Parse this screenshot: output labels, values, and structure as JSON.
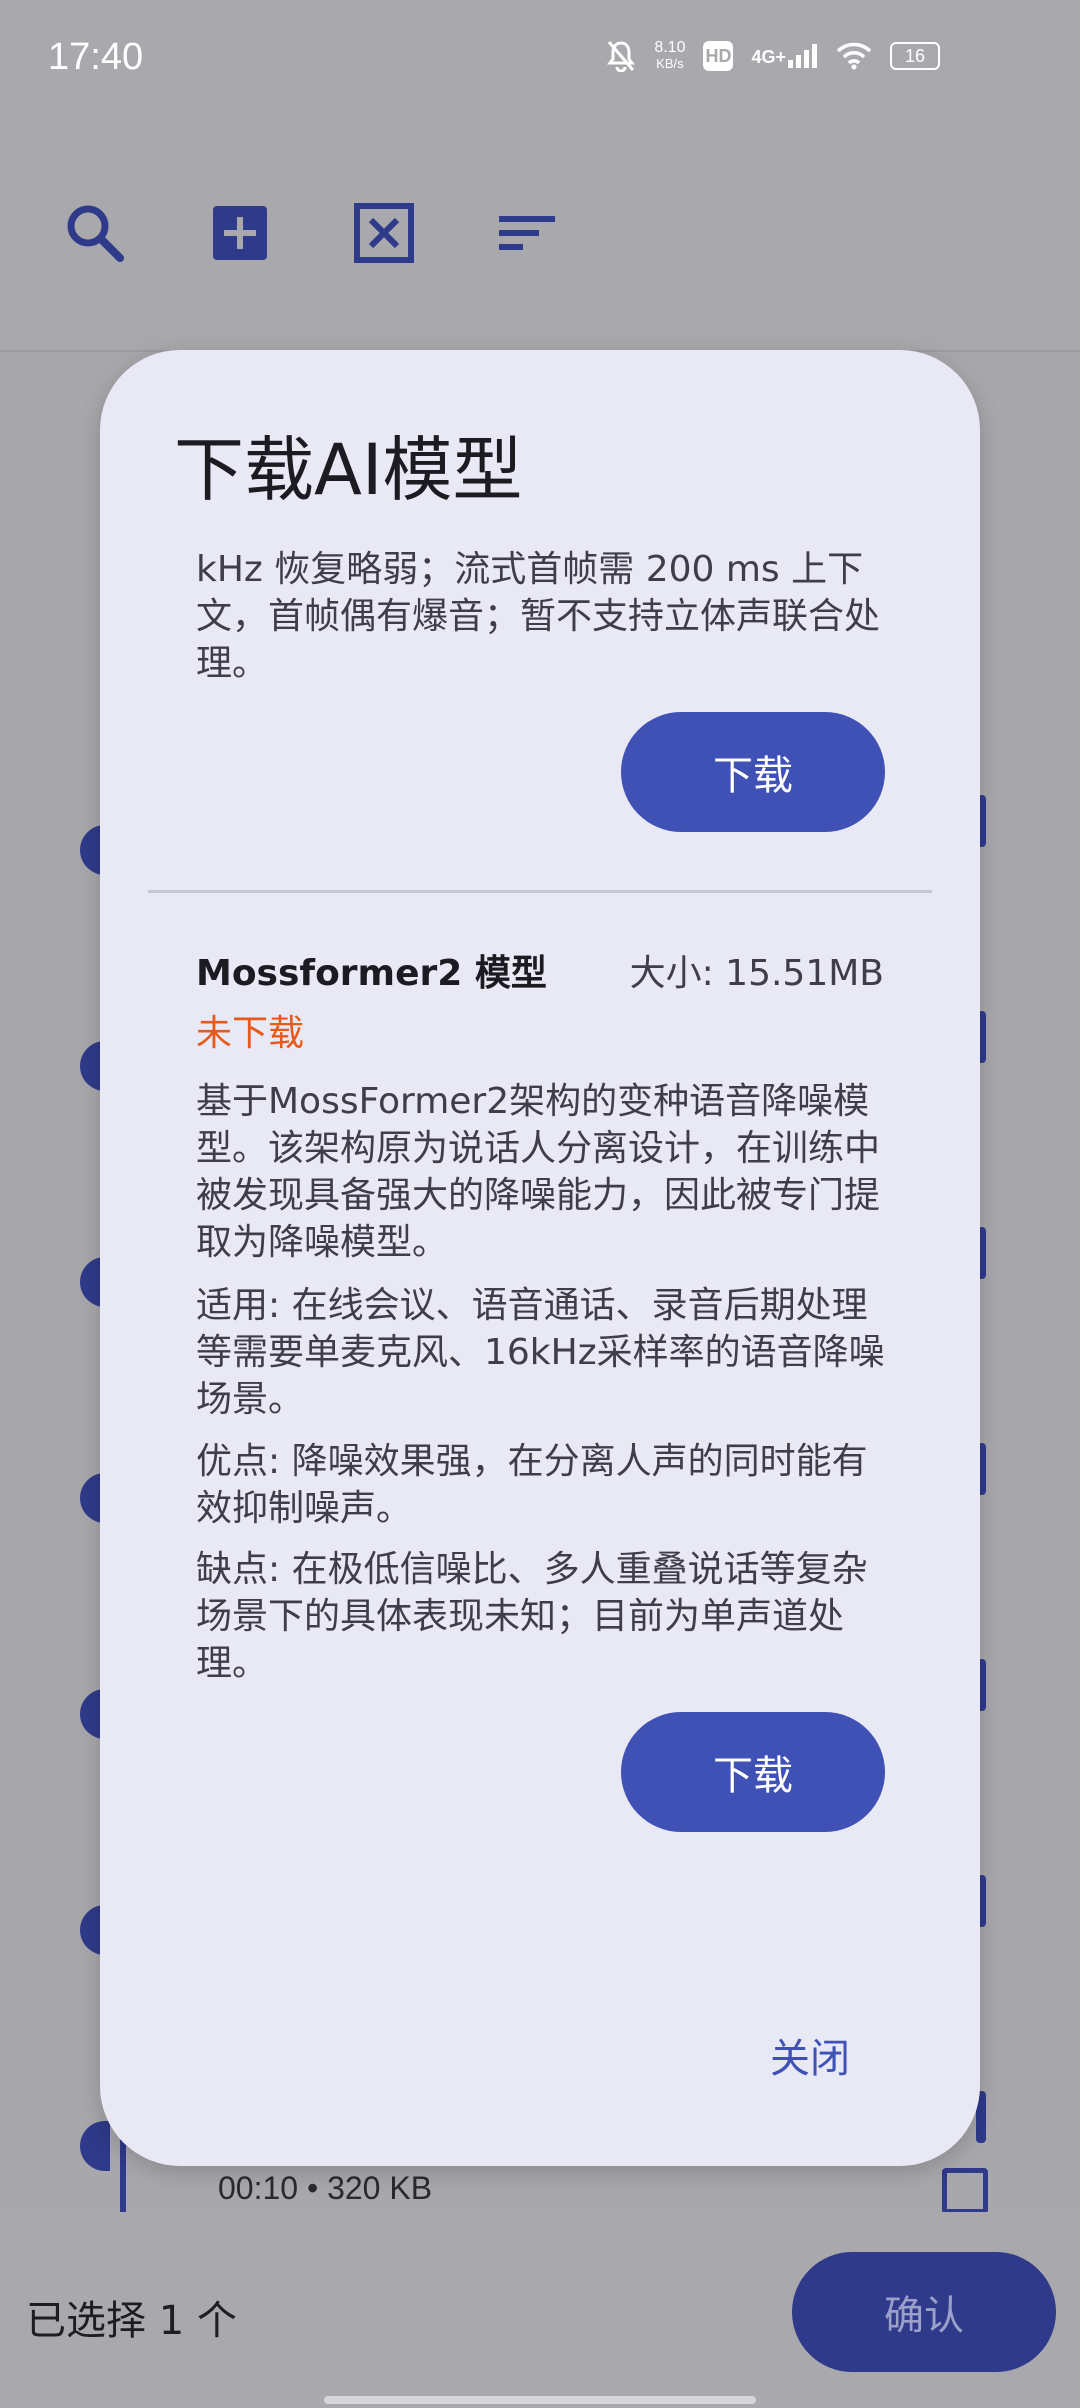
{
  "status_bar": {
    "time": "17:40",
    "net_speed_value": "8.10",
    "net_speed_unit": "KB/s",
    "hd_label": "HD",
    "signal_label": "4G+",
    "battery_level": "16"
  },
  "toolbar": {
    "icons": [
      "search-icon",
      "add-box-icon",
      "close-box-icon",
      "sort-icon"
    ]
  },
  "background_list": {
    "row_meta": "00:10 • 320 KB"
  },
  "bottom_bar": {
    "selected_text": "已选择 1 个",
    "confirm_label": "确认"
  },
  "dialog": {
    "title": "下载AI模型",
    "prev_model_tail": "kHz 恢复略弱；流式首帧需 200 ms 上下文，首帧偶有爆音；暂不支持立体声联合处理。",
    "download_label_1": "下载",
    "model": {
      "name": "Mossformer2 模型",
      "size": "大小: 15.51MB",
      "status": "未下载",
      "description": "基于MossFormer2架构的变种语音降噪模型。该架构原为说话人分离设计，在训练中被发现具备强大的降噪能力，因此被专门提取为降噪模型。",
      "applicable": "适用: 在线会议、语音通话、录音后期处理等需要单麦克风、16kHz采样率的语音降噪场景。",
      "pros": "优点: 降噪效果强，在分离人声的同时能有效抑制噪声。",
      "cons": "缺点: 在极低信噪比、多人重叠说话等复杂场景下的具体表现未知；目前为单声道处理。"
    },
    "download_label_2": "下载",
    "close_label": "关闭"
  },
  "colors": {
    "accent": "#3f51b5",
    "status_not_downloaded": "#e65a1e",
    "dialog_bg": "#e9e9f5",
    "scrim": "#a9a9ad"
  }
}
